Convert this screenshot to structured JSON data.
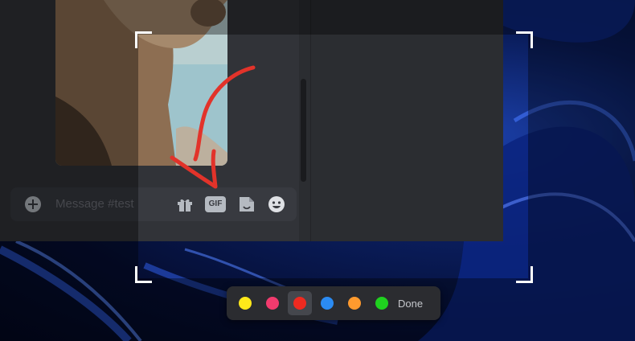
{
  "composer": {
    "placeholder": "Message #test",
    "gif_label": "GIF"
  },
  "annotation_toolbar": {
    "colors": [
      "#ffe81a",
      "#f23b6e",
      "#ee2a20",
      "#2b8bf2",
      "#ff9a2e",
      "#1fd11f"
    ],
    "selected_color": "#ee2a20",
    "done_label": "Done"
  },
  "ink": {
    "color": "#e2332a"
  }
}
